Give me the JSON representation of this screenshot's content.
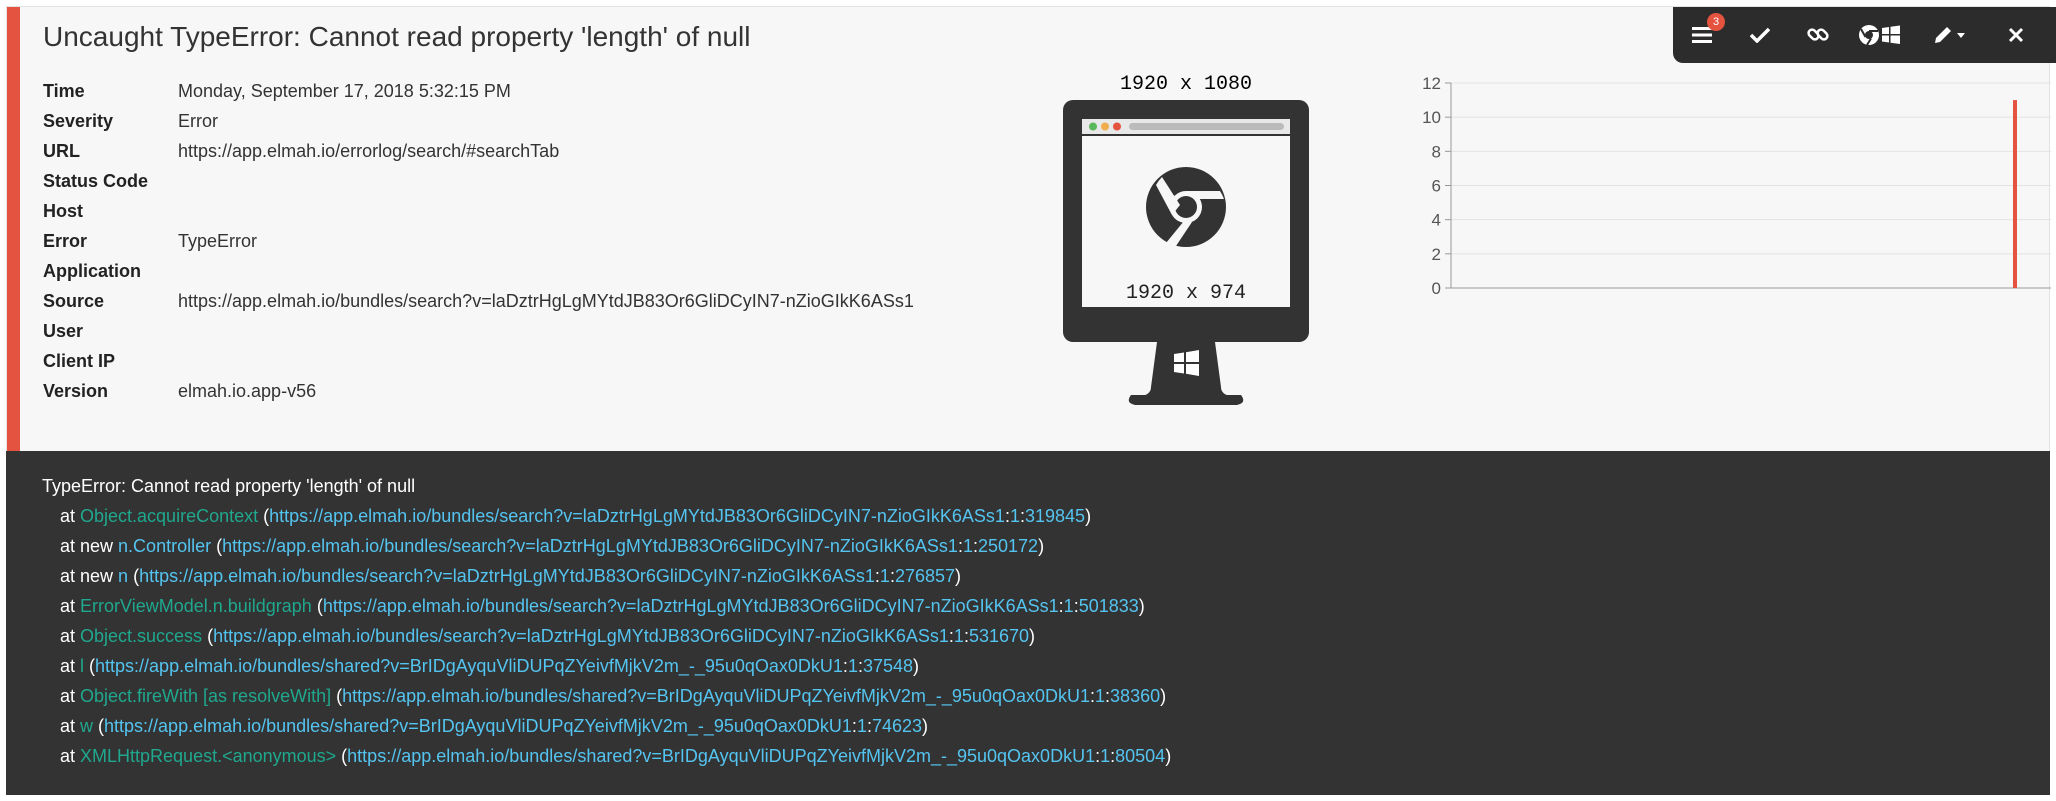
{
  "title": "Uncaught TypeError: Cannot read property 'length' of null",
  "details": [
    {
      "label": "Time",
      "value": "Monday, September 17, 2018 5:32:15 PM"
    },
    {
      "label": "Severity",
      "value": "Error"
    },
    {
      "label": "URL",
      "value": "https://app.elmah.io/errorlog/search/#searchTab"
    },
    {
      "label": "Status Code",
      "value": ""
    },
    {
      "label": "Host",
      "value": ""
    },
    {
      "label": "Error",
      "value": "TypeError"
    },
    {
      "label": "Application",
      "value": ""
    },
    {
      "label": "Source",
      "value": "https://app.elmah.io/bundles/search?v=laDztrHgLgMYtdJB83Or6GliDCyIN7-nZioGIkK6ASs1"
    },
    {
      "label": "User",
      "value": ""
    },
    {
      "label": "Client IP",
      "value": ""
    },
    {
      "label": "Version",
      "value": "elmah.io.app-v56"
    }
  ],
  "screen": {
    "resolution": "1920 x 1080",
    "viewport": "1920 x 974",
    "browser_icon": "chrome-icon",
    "os_icon": "windows-icon"
  },
  "toolbar": {
    "badge_count": "3",
    "icons": [
      "menu-icon",
      "check-icon",
      "link-icon",
      "browser-os-icon",
      "edit-icon",
      "close-icon"
    ]
  },
  "chart_data": {
    "type": "bar",
    "title": "",
    "xlabel": "",
    "ylabel": "",
    "ylim": [
      0,
      12
    ],
    "yticks": [
      "0",
      "2",
      "4",
      "6",
      "8",
      "10",
      "12"
    ],
    "grid": true,
    "series": [
      {
        "values": [
          11
        ],
        "positions": [
          0.94
        ]
      }
    ],
    "color": "#e4533f"
  },
  "stacktrace": {
    "header": "TypeError: Cannot read property 'length' of null",
    "frames": [
      {
        "prefix": "at ",
        "fn": "Object.acquireContext",
        "fnColor": "teal",
        "url": "https://app.elmah.io/bundles/search?v=laDztrHgLgMYtdJB83Or6GliDCyIN7-nZioGIkK6ASs1",
        "line": "1",
        "col": "319845"
      },
      {
        "prefix": "at new ",
        "fn": "n.Controller",
        "fnColor": "blue",
        "url": "https://app.elmah.io/bundles/search?v=laDztrHgLgMYtdJB83Or6GliDCyIN7-nZioGIkK6ASs1",
        "line": "1",
        "col": "250172"
      },
      {
        "prefix": "at new ",
        "fn": "n",
        "fnColor": "blue",
        "url": "https://app.elmah.io/bundles/search?v=laDztrHgLgMYtdJB83Or6GliDCyIN7-nZioGIkK6ASs1",
        "line": "1",
        "col": "276857"
      },
      {
        "prefix": "at ",
        "fn": "ErrorViewModel.n.buildgraph",
        "fnColor": "teal",
        "url": "https://app.elmah.io/bundles/search?v=laDztrHgLgMYtdJB83Or6GliDCyIN7-nZioGIkK6ASs1",
        "line": "1",
        "col": "501833"
      },
      {
        "prefix": "at ",
        "fn": "Object.success",
        "fnColor": "teal",
        "url": "https://app.elmah.io/bundles/search?v=laDztrHgLgMYtdJB83Or6GliDCyIN7-nZioGIkK6ASs1",
        "line": "1",
        "col": "531670"
      },
      {
        "prefix": "at ",
        "fn": "l",
        "fnColor": "teal",
        "url": "https://app.elmah.io/bundles/shared?v=BrIDgAyquVliDUPqZYeivfMjkV2m_-_95u0qOax0DkU1",
        "line": "1",
        "col": "37548"
      },
      {
        "prefix": "at ",
        "fn": "Object.fireWith [as resolveWith]",
        "fnColor": "teal",
        "url": "https://app.elmah.io/bundles/shared?v=BrIDgAyquVliDUPqZYeivfMjkV2m_-_95u0qOax0DkU1",
        "line": "1",
        "col": "38360"
      },
      {
        "prefix": "at ",
        "fn": "w",
        "fnColor": "teal",
        "url": "https://app.elmah.io/bundles/shared?v=BrIDgAyquVliDUPqZYeivfMjkV2m_-_95u0qOax0DkU1",
        "line": "1",
        "col": "74623"
      },
      {
        "prefix": "at ",
        "fn": "XMLHttpRequest.<anonymous>",
        "fnColor": "teal",
        "url": "https://app.elmah.io/bundles/shared?v=BrIDgAyquVliDUPqZYeivfMjkV2m_-_95u0qOax0DkU1",
        "line": "1",
        "col": "80504"
      }
    ]
  }
}
